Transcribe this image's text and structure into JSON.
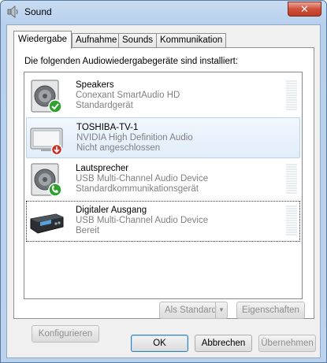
{
  "window": {
    "title": "Sound",
    "close_label": "✕"
  },
  "tabs": [
    {
      "label": "Wiedergabe"
    },
    {
      "label": "Aufnahme"
    },
    {
      "label": "Sounds"
    },
    {
      "label": "Kommunikation"
    }
  ],
  "panel": {
    "heading": "Die folgenden Audiowiedergabegeräte sind installiert:"
  },
  "devices": [
    {
      "name": "Speakers",
      "driver": "Conexant SmartAudio HD",
      "status": "Standardgerät",
      "icon": "speaker-default-icon",
      "badge_color": "#2ea12e"
    },
    {
      "name": "TOSHIBA-TV-1",
      "driver": "NVIDIA High Definition Audio",
      "status": "Nicht angeschlossen",
      "icon": "tv-disconnected-icon",
      "badge_color": "#c8312b"
    },
    {
      "name": "Lautsprecher",
      "driver": "USB Multi-Channel Audio Device",
      "status": "Standardkommunikationsgerät",
      "icon": "speaker-communication-icon",
      "badge_color": "#2ea12e"
    },
    {
      "name": "Digitaler Ausgang",
      "driver": "USB Multi-Channel Audio Device",
      "status": "Bereit",
      "icon": "digital-output-icon"
    }
  ],
  "buttons": {
    "configure": "Konfigurieren",
    "set_default": "Als Standard",
    "properties": "Eigenschaften",
    "ok": "OK",
    "cancel": "Abbrechen",
    "apply": "Übernehmen"
  }
}
